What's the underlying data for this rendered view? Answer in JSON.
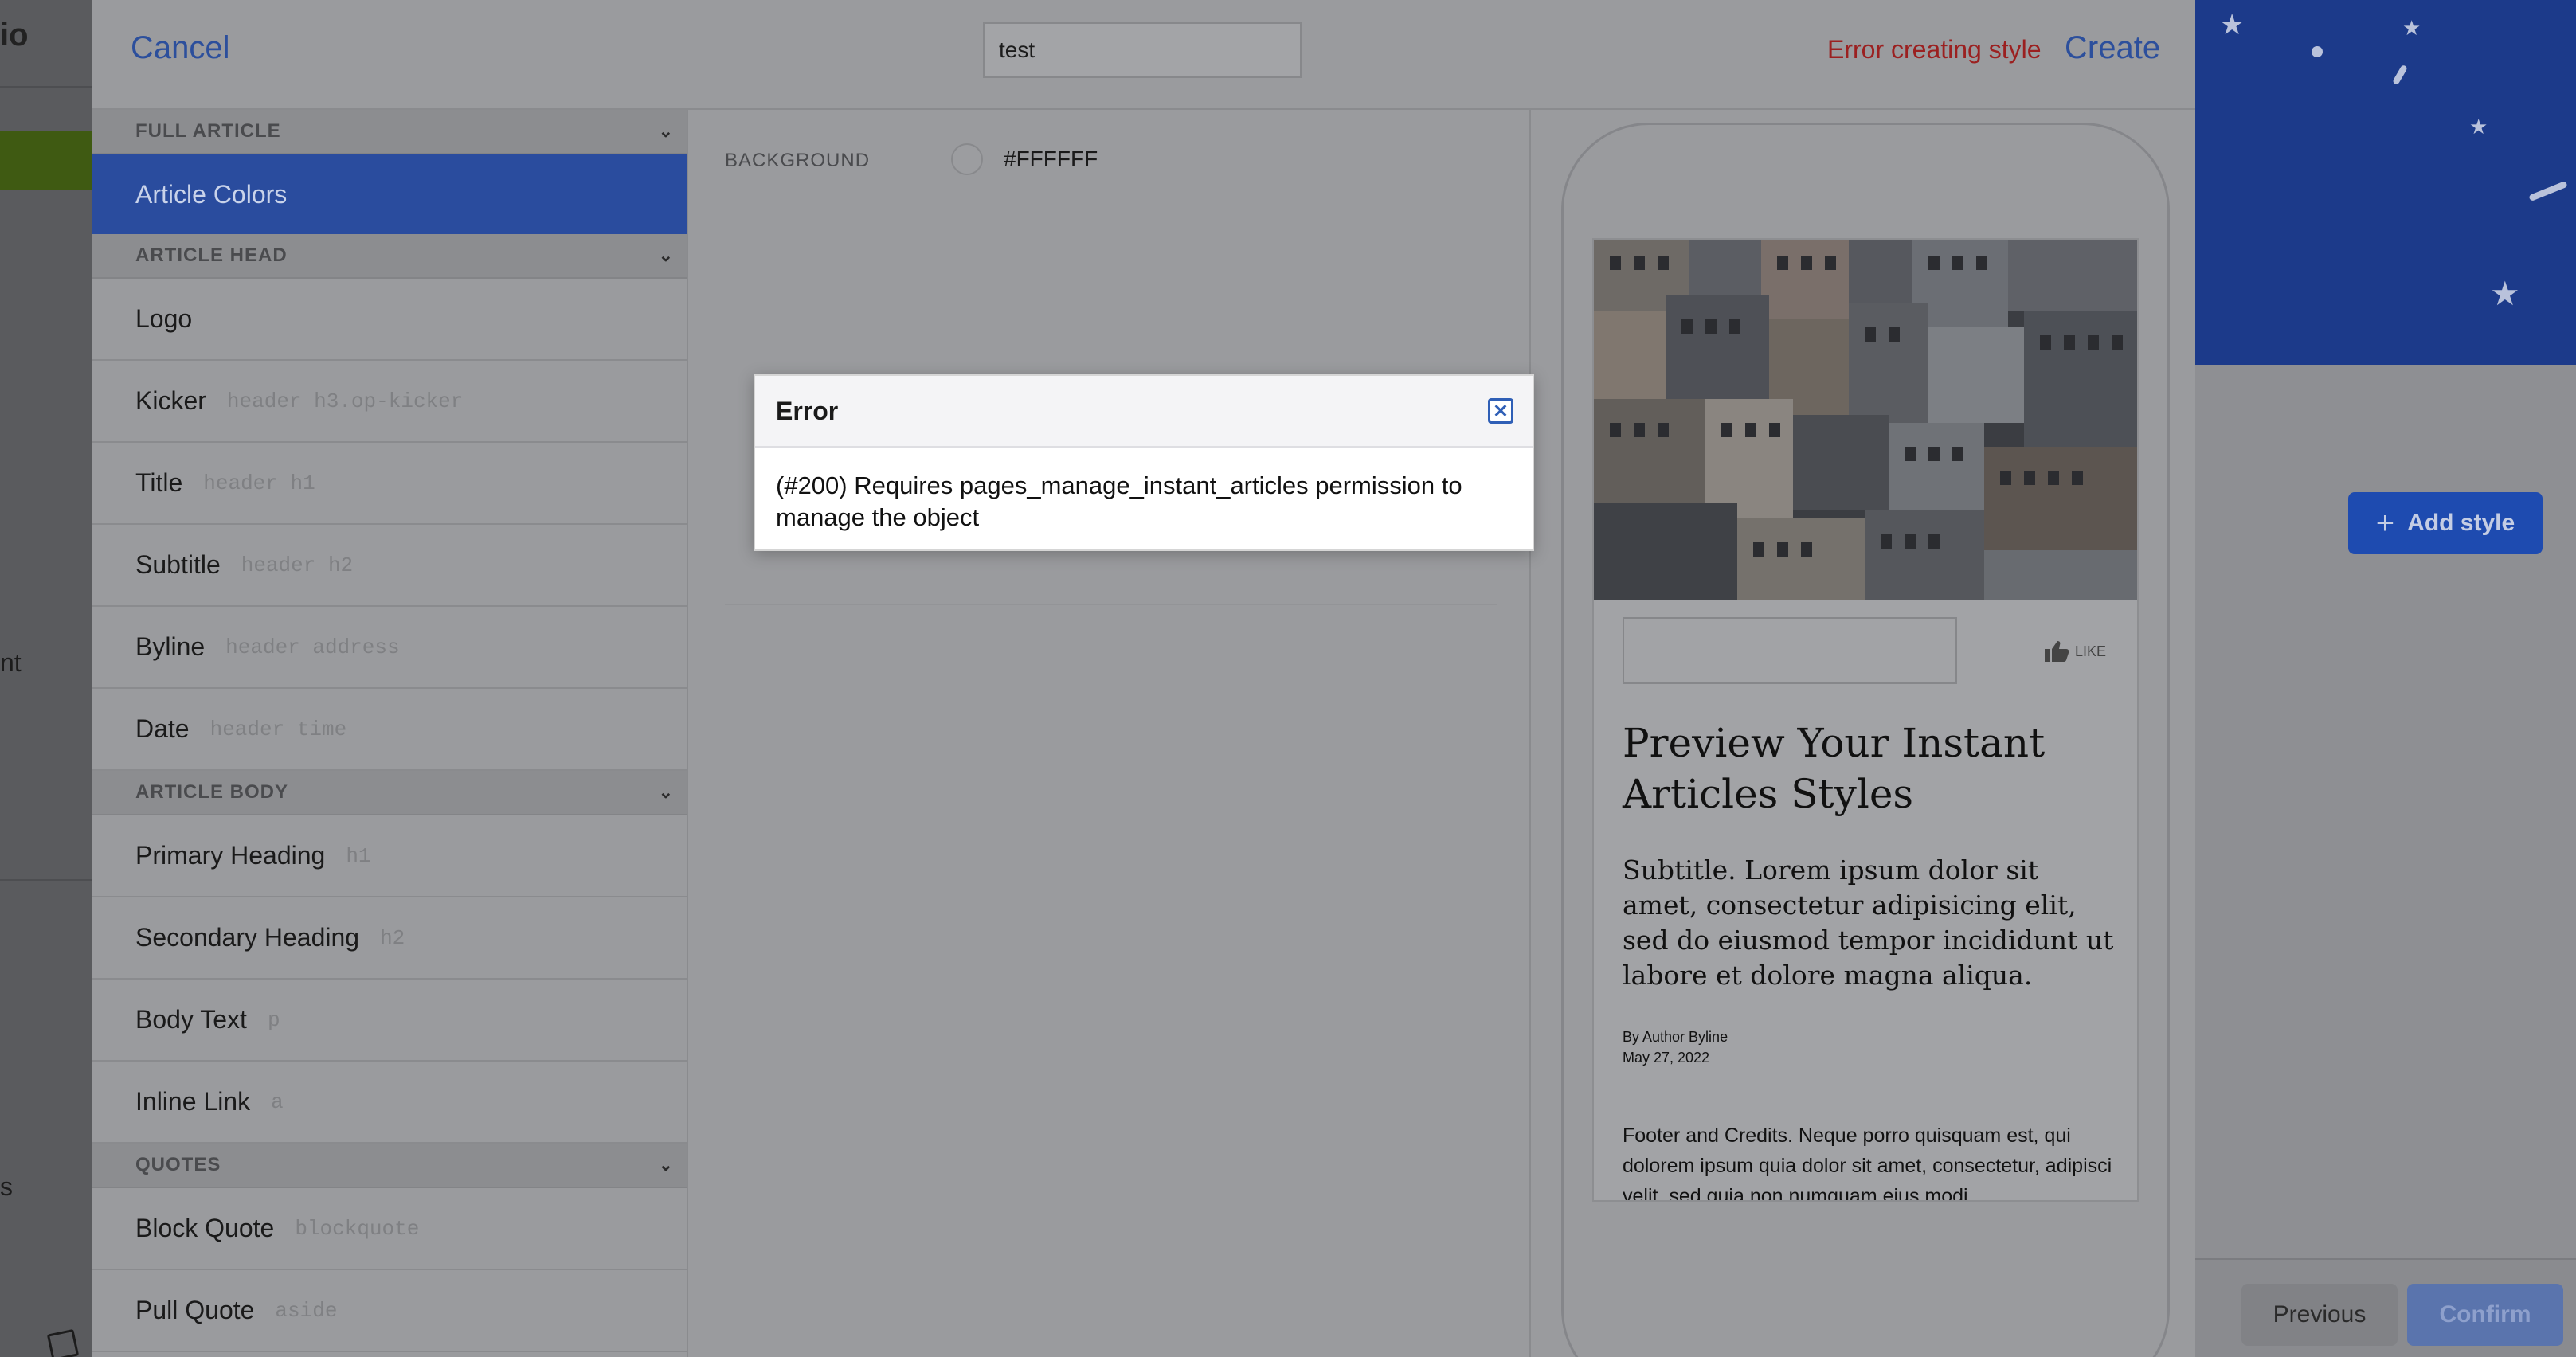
{
  "background_page": {
    "title_fragment": "io",
    "side_text_1": "nt",
    "side_text_2": "s",
    "add_style_label": "Add style",
    "previous_label": "Previous",
    "confirm_label": "Confirm"
  },
  "toolbar": {
    "cancel_label": "Cancel",
    "style_name_value": "test",
    "error_status": "Error creating style",
    "create_label": "Create"
  },
  "sidebar": {
    "sections": [
      {
        "header": "FULL ARTICLE",
        "items": [
          {
            "label": "Article Colors",
            "selector": "",
            "active": true
          }
        ]
      },
      {
        "header": "ARTICLE HEAD",
        "items": [
          {
            "label": "Logo",
            "selector": ""
          },
          {
            "label": "Kicker",
            "selector": "header h3.op-kicker"
          },
          {
            "label": "Title",
            "selector": "header h1"
          },
          {
            "label": "Subtitle",
            "selector": "header h2"
          },
          {
            "label": "Byline",
            "selector": "header address"
          },
          {
            "label": "Date",
            "selector": "header time"
          }
        ]
      },
      {
        "header": "ARTICLE BODY",
        "items": [
          {
            "label": "Primary Heading",
            "selector": "h1"
          },
          {
            "label": "Secondary Heading",
            "selector": "h2"
          },
          {
            "label": "Body Text",
            "selector": "p"
          },
          {
            "label": "Inline Link",
            "selector": "a"
          }
        ]
      },
      {
        "header": "QUOTES",
        "items": [
          {
            "label": "Block Quote",
            "selector": "blockquote"
          },
          {
            "label": "Pull Quote",
            "selector": "aside"
          }
        ]
      }
    ]
  },
  "settings": {
    "background_label": "BACKGROUND",
    "background_value": "#FFFFFF"
  },
  "preview": {
    "like_label": "LIKE",
    "title": "Preview Your Instant Articles Styles",
    "subtitle": "Subtitle. Lorem ipsum dolor sit amet, consectetur adipisicing elit, sed do eiusmod tempor incididunt ut labore et dolore magna aliqua.",
    "byline": "By Author Byline",
    "date": "May 27, 2022",
    "footer": "Footer and Credits. Neque porro quisquam est, qui dolorem ipsum quia dolor sit amet, consectetur, adipisci velit, sed quia non numquam eius modi"
  },
  "error_dialog": {
    "title": "Error",
    "message": "(#200) Requires pages_manage_instant_articles permission to manage the object"
  },
  "colors": {
    "accent": "#2a4c9e",
    "error": "#9b2020",
    "dialog_close": "#2f5fb6"
  }
}
